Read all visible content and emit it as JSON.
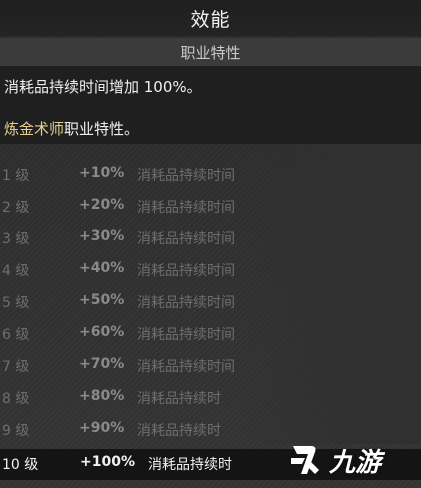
{
  "header": {
    "title": "效能"
  },
  "section": {
    "title": "职业特性"
  },
  "description": {
    "line1": "消耗品持续时间增加 100%。",
    "class_name": "炼金术师",
    "line2_suffix": "职业特性。"
  },
  "levels": [
    {
      "level": "1 级",
      "bonus": "+10%",
      "effect": "消耗品持续时间"
    },
    {
      "level": "2 级",
      "bonus": "+20%",
      "effect": "消耗品持续时间"
    },
    {
      "level": "3 级",
      "bonus": "+30%",
      "effect": "消耗品持续时间"
    },
    {
      "level": "4 级",
      "bonus": "+40%",
      "effect": "消耗品持续时间"
    },
    {
      "level": "5 级",
      "bonus": "+50%",
      "effect": "消耗品持续时间"
    },
    {
      "level": "6 级",
      "bonus": "+60%",
      "effect": "消耗品持续时间"
    },
    {
      "level": "7 级",
      "bonus": "+70%",
      "effect": "消耗品持续时间"
    },
    {
      "level": "8 级",
      "bonus": "+80%",
      "effect": "消耗品持续时"
    },
    {
      "level": "9 级",
      "bonus": "+90%",
      "effect": "消耗品持续时"
    },
    {
      "level": "10 级",
      "bonus": "+100%",
      "effect": "消耗品持续时"
    }
  ],
  "current_level_index": 9,
  "watermark": {
    "text": "九游",
    "icon": "jiuyou-logo-icon"
  },
  "colors": {
    "class_name": "#e6cf8e",
    "dim_text": "#6e6e6e",
    "bright_text": "#f2f2f2"
  }
}
